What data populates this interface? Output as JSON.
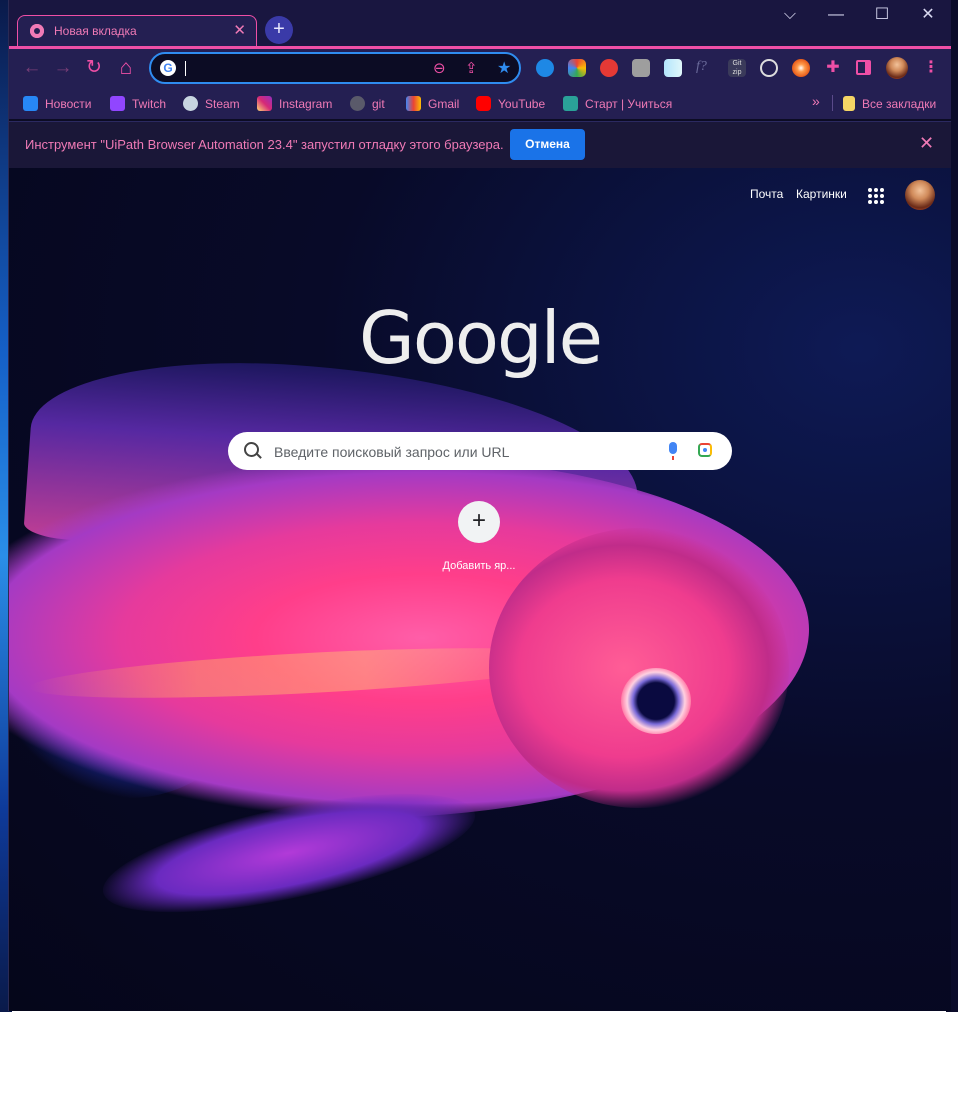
{
  "window": {
    "tab_title": "Новая вкладка",
    "tab_close": "✕",
    "new_tab": "+",
    "controls": [
      "⌵",
      "—",
      "☐",
      "✕"
    ]
  },
  "toolbar": {
    "back": "←",
    "forward": "→",
    "reload": "↻",
    "home": "⌂",
    "omnibox_g": "G",
    "zoom": "⊖",
    "share": "⇪",
    "star": "★"
  },
  "bookmarks": {
    "items": [
      {
        "label": "Новости",
        "icon": "vk-icon",
        "color": "#2787f5"
      },
      {
        "label": "Twitch",
        "icon": "twitch-icon",
        "color": "#9146ff"
      },
      {
        "label": "Steam",
        "icon": "steam-icon",
        "color": "#1b2838"
      },
      {
        "label": "Instagram",
        "icon": "instagram-icon",
        "color": "#e1306c"
      },
      {
        "label": "git",
        "icon": "github-icon",
        "color": "#2b2b2b"
      },
      {
        "label": "Gmail",
        "icon": "gmail-icon",
        "color": "#ea4335"
      },
      {
        "label": "YouTube",
        "icon": "youtube-icon",
        "color": "#ff0000"
      },
      {
        "label": "Старт | Учиться",
        "icon": "book-icon",
        "color": "#2aa198"
      }
    ],
    "overflow": "»",
    "all_bookmarks": "Все закладки"
  },
  "infobar": {
    "message": "Инструмент \"UiPath Browser Automation 23.4\" запустил отладку этого браузера.",
    "cancel": "Отмена",
    "close": "✕"
  },
  "ntp": {
    "mail": "Почта",
    "images": "Картинки",
    "logo": "Google",
    "search_placeholder": "Введите поисковый запрос или URL",
    "add_shortcut_icon": "+",
    "add_shortcut_label": "Добавить яр..."
  },
  "colors": {
    "accent": "#ef4fa6",
    "frame": "#191640",
    "toolbar": "#241f52",
    "button_blue": "#1a73e8"
  }
}
